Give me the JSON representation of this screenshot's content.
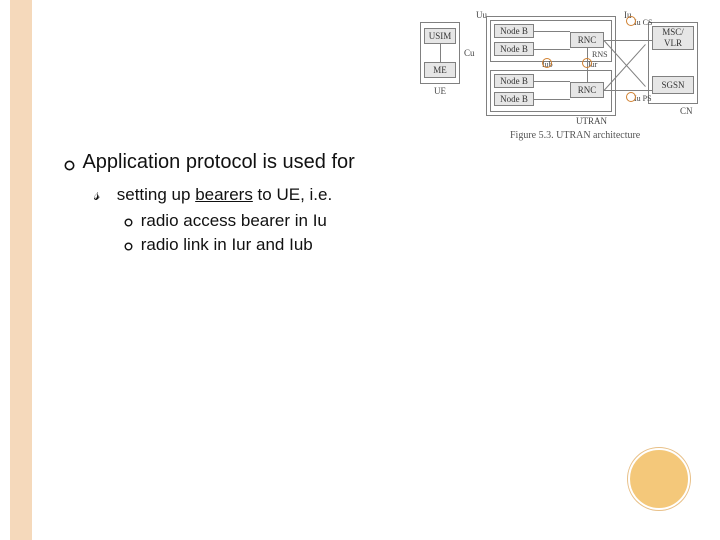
{
  "content": {
    "l1": "Application protocol is used for",
    "l2_pre": "setting up ",
    "l2_underlined": "bearers",
    "l2_post": " to UE, i.e.",
    "l3a": "radio access bearer in Iu",
    "l3b": "radio link in Iur and Iub"
  },
  "diagram": {
    "caption": "Figure 5.3. UTRAN architecture",
    "ue": {
      "usim": "USIM",
      "me": "ME",
      "label": "UE",
      "cu": "Cu"
    },
    "utran": {
      "nodeB": "Node B",
      "rnc": "RNC",
      "rns": "RNS",
      "label": "UTRAN",
      "iub": "Iub",
      "iur": "Iur",
      "uu": "Uu"
    },
    "cn": {
      "msc": "MSC/\nVLR",
      "sgsn": "SGSN",
      "label": "CN",
      "iucs": "Iu CS",
      "iups": "Iu PS",
      "iu": "Iu"
    }
  }
}
